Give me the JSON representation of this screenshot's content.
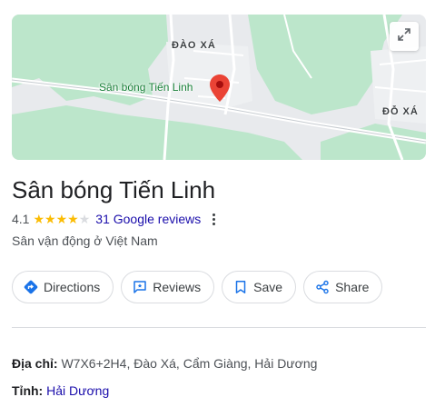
{
  "map": {
    "labels": {
      "dao_xa": "ĐÀO XÁ",
      "do_xa": "ĐỖ XÁ"
    },
    "pin_label": "Sân bóng Tiến Linh",
    "colors": {
      "land": "#e8eaed",
      "green": "#bce6cb",
      "road": "#ffffff",
      "pin": "#ea4335",
      "pin_label": "#188038"
    },
    "icons": {
      "pin": "map-pin-icon",
      "expand": "expand-icon"
    }
  },
  "place": {
    "title": "Sân bóng Tiến Linh",
    "rating": "4.1",
    "stars": 4.1,
    "reviews": "31 Google reviews",
    "category": "Sân vận động ở Việt Nam"
  },
  "actions": [
    {
      "label": "Directions",
      "icon": "directions-icon"
    },
    {
      "label": "Reviews",
      "icon": "reviews-icon"
    },
    {
      "label": "Save",
      "icon": "bookmark-icon"
    },
    {
      "label": "Share",
      "icon": "share-icon"
    }
  ],
  "details": {
    "address_label": "Địa chỉ",
    "address_value": "W7X6+2H4, Đào Xá, Cẩm Giàng, Hải Dương",
    "province_label": "Tỉnh",
    "province_value": "Hải Dương"
  },
  "colors": {
    "link": "#1a0dab",
    "star": "#fbbc04",
    "star_empty": "#dadce0",
    "directions_accent": "#1a73e8"
  }
}
